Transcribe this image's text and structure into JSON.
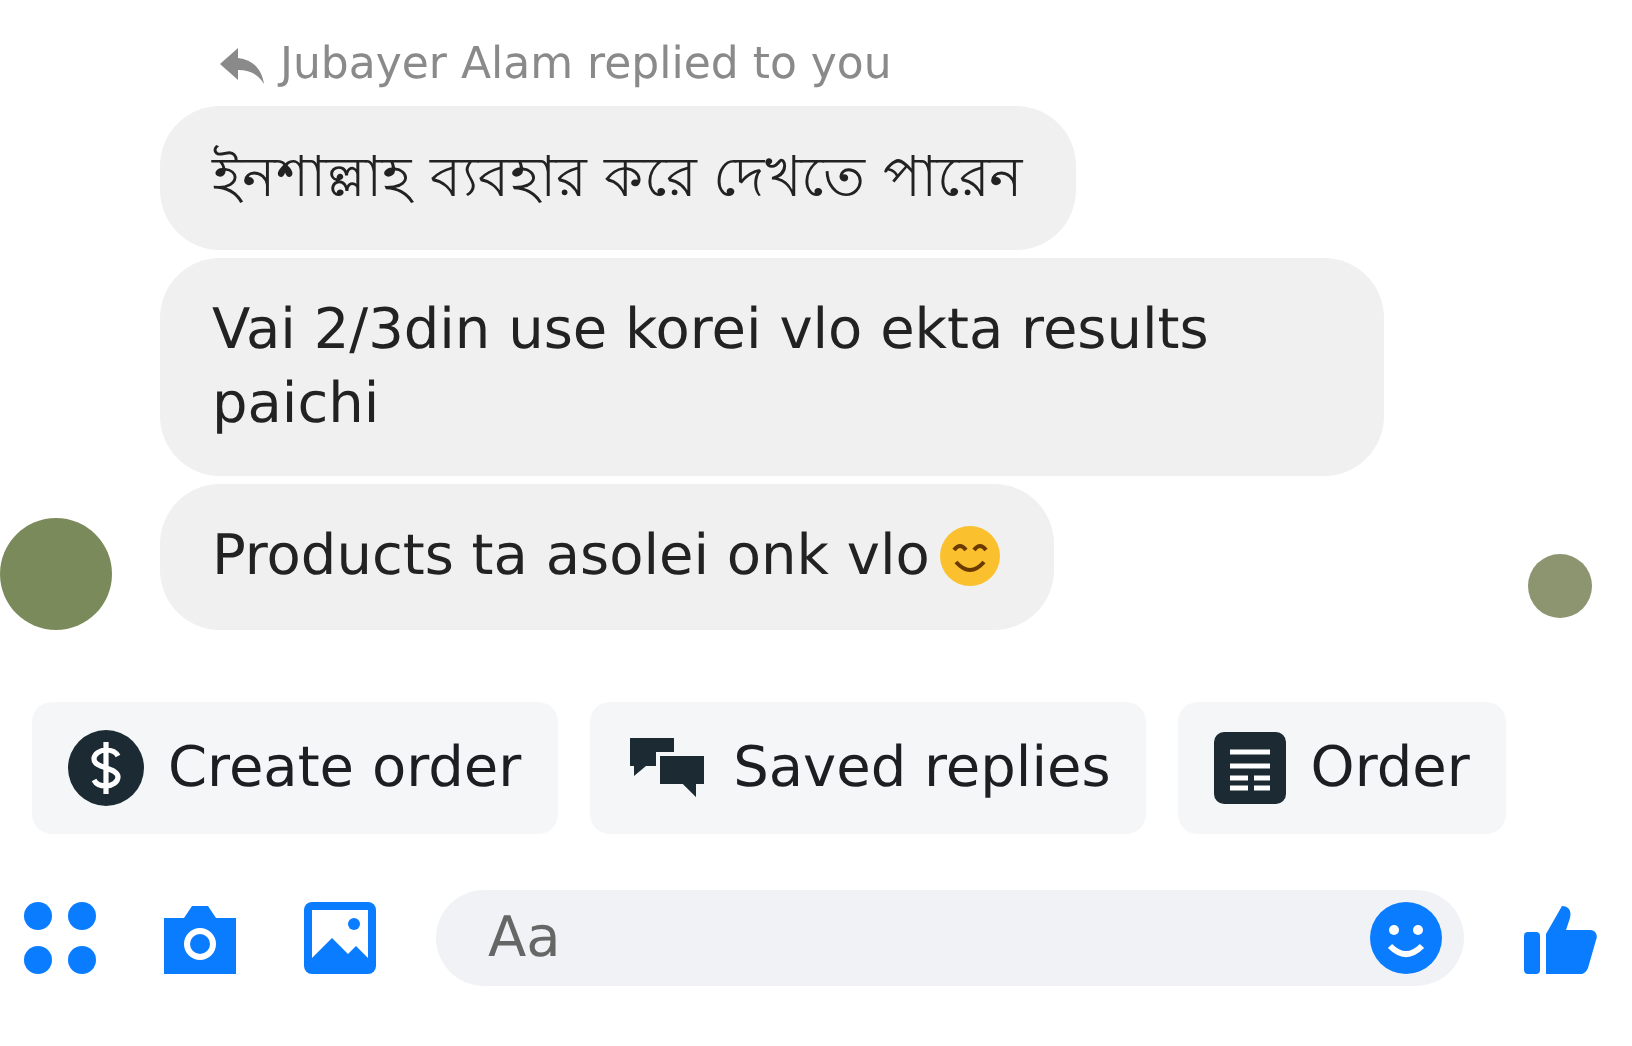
{
  "reply_header": {
    "text": "Jubayer Alam replied to you"
  },
  "messages": [
    {
      "text": "ইনশাল্লাহ ব্যবহার করে দেখতে পারেন",
      "emoji": false
    },
    {
      "text": "Vai 2/3din use korei vlo ekta results paichi",
      "emoji": false
    },
    {
      "text": "Products ta asolei onk vlo",
      "emoji": true
    }
  ],
  "sender_avatar": true,
  "seen_avatar": true,
  "quick_replies": [
    {
      "kind": "dollar",
      "label": "Create order"
    },
    {
      "kind": "chat",
      "label": "Saved replies"
    },
    {
      "kind": "list",
      "label": "Order"
    }
  ],
  "composer": {
    "placeholder": "Aa"
  }
}
